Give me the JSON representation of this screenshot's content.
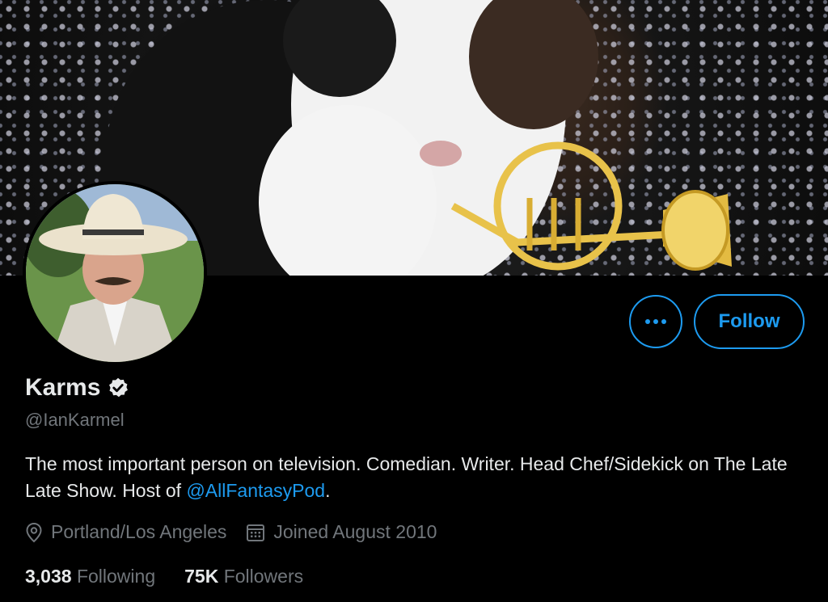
{
  "banner": {
    "image": "guinea-pig-with-french-horn"
  },
  "avatar": {
    "image": "man-in-cowboy-hat"
  },
  "actions": {
    "more_icon": "more-horizontal-icon",
    "follow_label": "Follow"
  },
  "profile": {
    "name": "Karms",
    "verified_icon": "verified-badge-icon",
    "handle": "@IanKarmel",
    "bio_text": "The most important person on television. Comedian. Writer. Head Chef/Sidekick on The Late Late Show. Host of ",
    "bio_link": "@AllFantasyPod",
    "bio_end": ".",
    "location_icon": "location-pin-icon",
    "location": "Portland/Los Angeles",
    "calendar_icon": "calendar-icon",
    "joined": "Joined August 2010"
  },
  "stats": {
    "following_count": "3,038",
    "following_label": "Following",
    "followers_count": "75K",
    "followers_label": "Followers"
  },
  "colors": {
    "accent": "#1d9bf0",
    "background": "#000000",
    "muted": "#71767b"
  }
}
